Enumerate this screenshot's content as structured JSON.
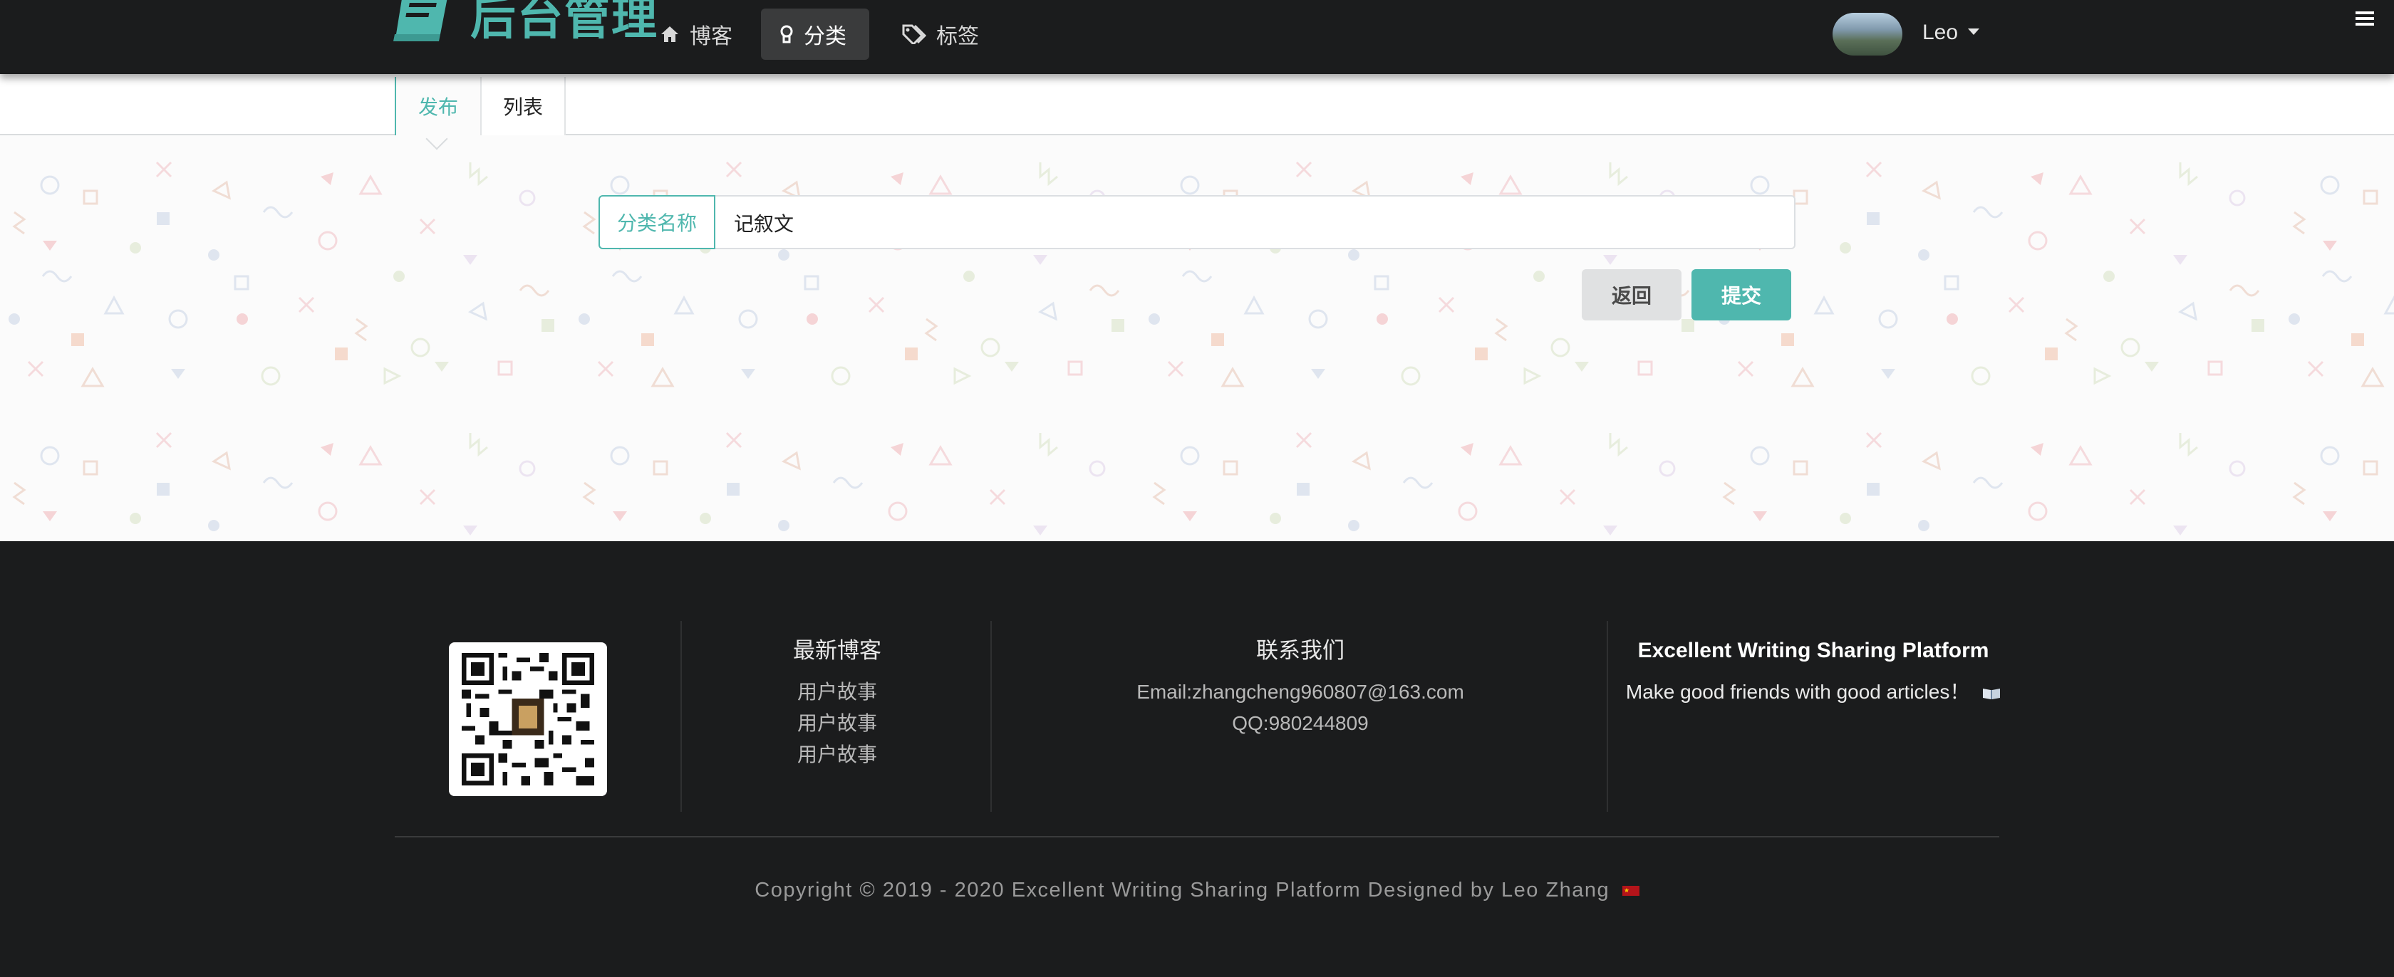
{
  "header": {
    "logo_text": "后台管理",
    "nav": [
      {
        "label": "博客",
        "icon": "home-icon"
      },
      {
        "label": "分类",
        "icon": "lightbulb-icon",
        "active": true
      },
      {
        "label": "标签",
        "icon": "tags-icon"
      }
    ],
    "user_name": "Leo"
  },
  "tabs": [
    {
      "label": "发布",
      "active": true
    },
    {
      "label": "列表",
      "active": false
    }
  ],
  "form": {
    "field_label": "分类名称",
    "field_value": "记叙文",
    "back_label": "返回",
    "submit_label": "提交"
  },
  "footer": {
    "latest": {
      "title": "最新博客",
      "items": [
        "用户故事",
        "用户故事",
        "用户故事"
      ]
    },
    "contact": {
      "title": "联系我们",
      "email": "Email:zhangcheng960807@163.com",
      "qq": "QQ:980244809"
    },
    "brand": {
      "title": "Excellent Writing Sharing Platform",
      "text": "Make good friends with good articles！"
    },
    "copyright": "Copyright © 2019 - 2020 Excellent Writing Sharing Platform Designed by Leo Zhang"
  },
  "colors": {
    "accent": "#4fb7ae",
    "dark": "#1b1c1d",
    "button_grey": "#e0e1e2"
  }
}
